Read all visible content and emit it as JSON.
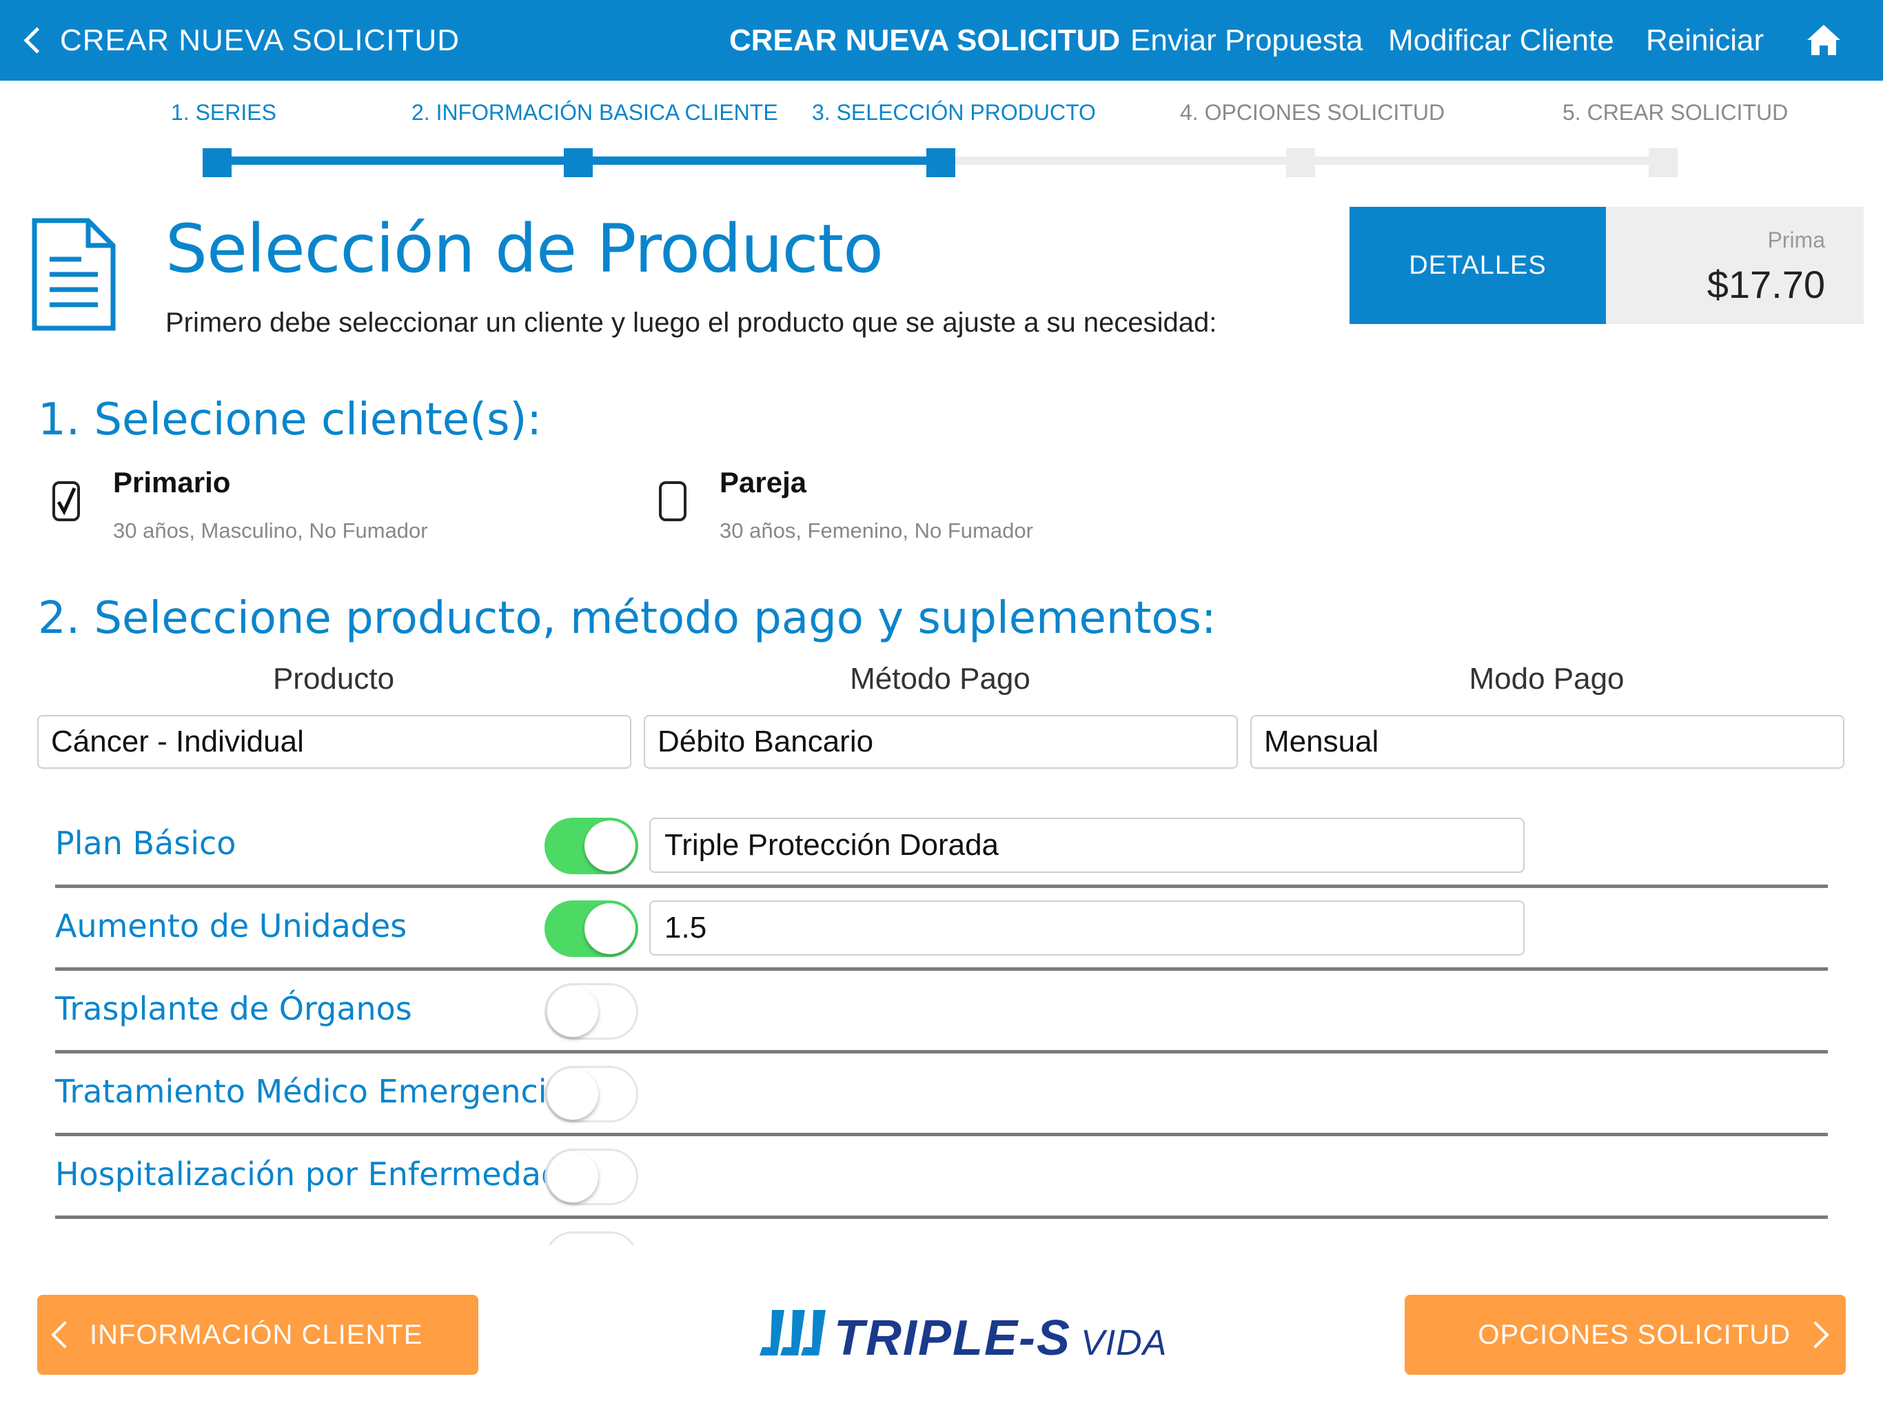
{
  "header": {
    "back_label": "CREAR NUEVA SOLICITUD",
    "title": "CREAR NUEVA SOLICITUD",
    "links": [
      "Enviar Propuesta",
      "Modificar Cliente",
      "Reiniciar"
    ],
    "home_icon": "home-icon",
    "color": "#0a85cc"
  },
  "stepper": {
    "steps": [
      "1. SERIES",
      "2. INFORMACIÓN BASICA CLIENTE",
      "3. SELECCIÓN PRODUCTO",
      "4. OPCIONES SOLICITUD",
      "5. CREAR SOLICITUD"
    ],
    "current_step": 3
  },
  "page": {
    "title": "Selección de Producto",
    "subtitle": "Primero debe seleccionar un cliente y luego el producto que se ajuste a su necesidad:",
    "document_icon": "document-icon"
  },
  "summary": {
    "details_label": "DETALLES",
    "prima_label": "Prima",
    "prima_value": "$17.70"
  },
  "clients": {
    "heading": "1. Selecione cliente(s):",
    "items": [
      {
        "name": "Primario",
        "desc": "30 años, Masculino, No Fumador",
        "checked": true
      },
      {
        "name": "Pareja",
        "desc": "30 años, Femenino, No Fumador",
        "checked": false
      }
    ]
  },
  "product": {
    "heading": "2. Seleccione producto, método pago y suplementos:",
    "columns": [
      {
        "label": "Producto",
        "value": "Cáncer - Individual"
      },
      {
        "label": "Método Pago",
        "value": "Débito Bancario"
      },
      {
        "label": "Modo Pago",
        "value": "Mensual"
      }
    ]
  },
  "supplements": [
    {
      "label": "Plan Básico",
      "on": true,
      "value": "Triple Protección Dorada"
    },
    {
      "label": "Aumento de Unidades",
      "on": true,
      "value": "1.5"
    },
    {
      "label": "Trasplante de Órganos",
      "on": false,
      "value": ""
    },
    {
      "label": "Tratamiento Médico Emergencia",
      "on": false,
      "value": ""
    },
    {
      "label": "Hospitalización por Enfermedad",
      "on": false,
      "value": ""
    }
  ],
  "footer": {
    "back_label": "INFORMACIÓN CLIENTE",
    "next_label": "OPCIONES SOLICITUD",
    "logo_main": "TRIPLE-S",
    "logo_sub": "VIDA",
    "button_color": "#ff9e42"
  }
}
